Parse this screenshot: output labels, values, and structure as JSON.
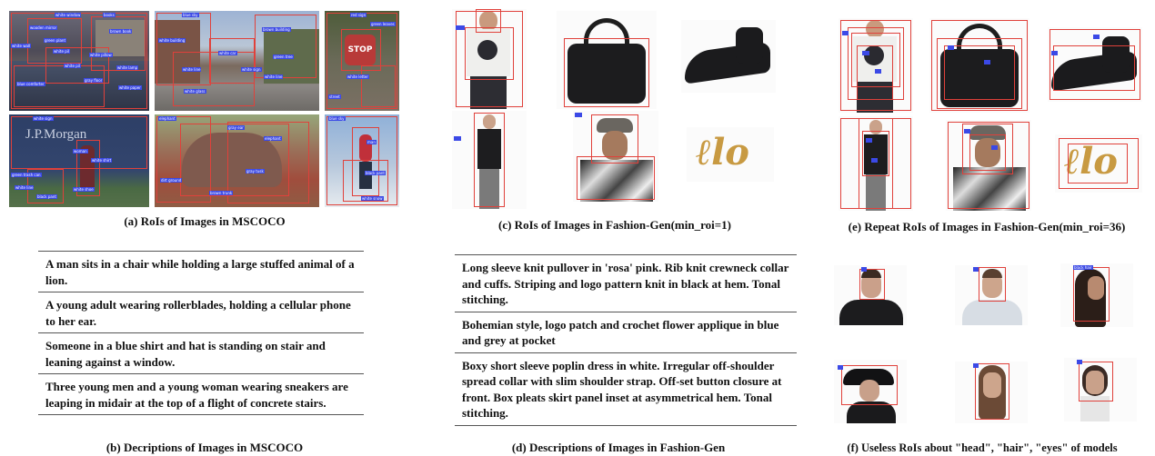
{
  "captions": {
    "a": "(a) RoIs of Images in MSCOCO",
    "b": "(b) Decriptions of Images in MSCOCO",
    "c": "(c) RoIs of Images in Fashion-Gen(min_roi=1)",
    "d": "(d) Descriptions of Images in Fashion-Gen",
    "e": "(e) Repeat RoIs of Images in Fashion-Gen(min_roi=36)",
    "f": "(f) Useless RoIs about \"head\", \"hair\", \"eyes\" of models"
  },
  "mscoco_descriptions": [
    "A man sits in a chair while holding a large stuffed animal of a lion.",
    "A young adult wearing rollerblades, holding a cellular phone to her ear.",
    "Someone in a blue shirt and hat is standing on stair and leaning against a window.",
    "Three young men and a young woman wearing sneakers are leaping in midair at the top of a flight of concrete stairs."
  ],
  "fashion_descriptions": [
    "Long sleeve knit pullover in 'rosa' pink. Rib knit crewneck collar and cuffs. Striping and logo pattern knit in black at hem. Tonal stitching.",
    "Bohemian style, logo patch and crochet flower applique in blue and grey at pocket",
    "Boxy short sleeve poplin dress in white. Irregular off-shoulder spread collar with slim shoulder strap. Off-set button closure at front. Box pleats skirt panel inset at asymmetrical hem. Tonal stitching."
  ],
  "image_text": {
    "bank_sign": "J.P.Morgan",
    "stop_sign": "STOP"
  },
  "roi_labels": {
    "coco1": [
      "white window",
      "books",
      "wooden mirror",
      "brown book",
      "green plant",
      "white pil",
      "white pillow",
      "white wall",
      "blue comforter",
      "gray floor",
      "white pil",
      "white lamp",
      "white paper"
    ],
    "coco2": [
      "blue sky",
      "brown building",
      "white line",
      "white car",
      "white glass",
      "green tree",
      "white building",
      "white sign",
      "white line"
    ],
    "coco3": [
      "red sign",
      "white letter",
      "green leaves",
      "street"
    ],
    "coco4": [
      "white sign",
      "woman",
      "white shirt",
      "green trash can",
      "white line",
      "white shoe",
      "black pant"
    ],
    "coco5": [
      "elephant",
      "gray ear",
      "elephant",
      "dirt ground",
      "brown trunk",
      "gray tusk"
    ],
    "coco6": [
      "blue sky",
      "man",
      "black pant",
      "white snow"
    ],
    "hair_roi": "black hair"
  },
  "colors": {
    "roi_box": "#e0413b",
    "roi_label": "#3b49e6"
  }
}
